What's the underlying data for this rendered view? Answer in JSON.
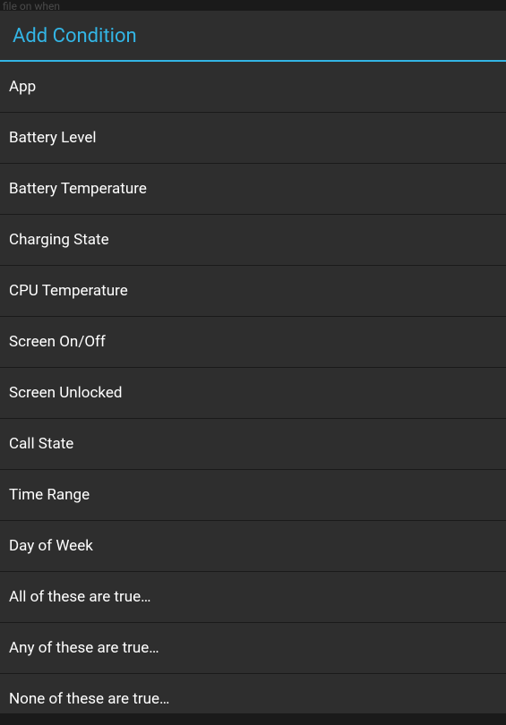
{
  "background_text": "file on when",
  "dialog": {
    "title": "Add Condition",
    "items": [
      {
        "label": "App"
      },
      {
        "label": "Battery Level"
      },
      {
        "label": "Battery Temperature"
      },
      {
        "label": "Charging State"
      },
      {
        "label": "CPU Temperature"
      },
      {
        "label": "Screen On/Off"
      },
      {
        "label": "Screen Unlocked"
      },
      {
        "label": "Call State"
      },
      {
        "label": "Time Range"
      },
      {
        "label": "Day of Week"
      },
      {
        "label": "All of these are true…"
      },
      {
        "label": "Any of these are true…"
      },
      {
        "label": "None of these are true…"
      }
    ]
  }
}
